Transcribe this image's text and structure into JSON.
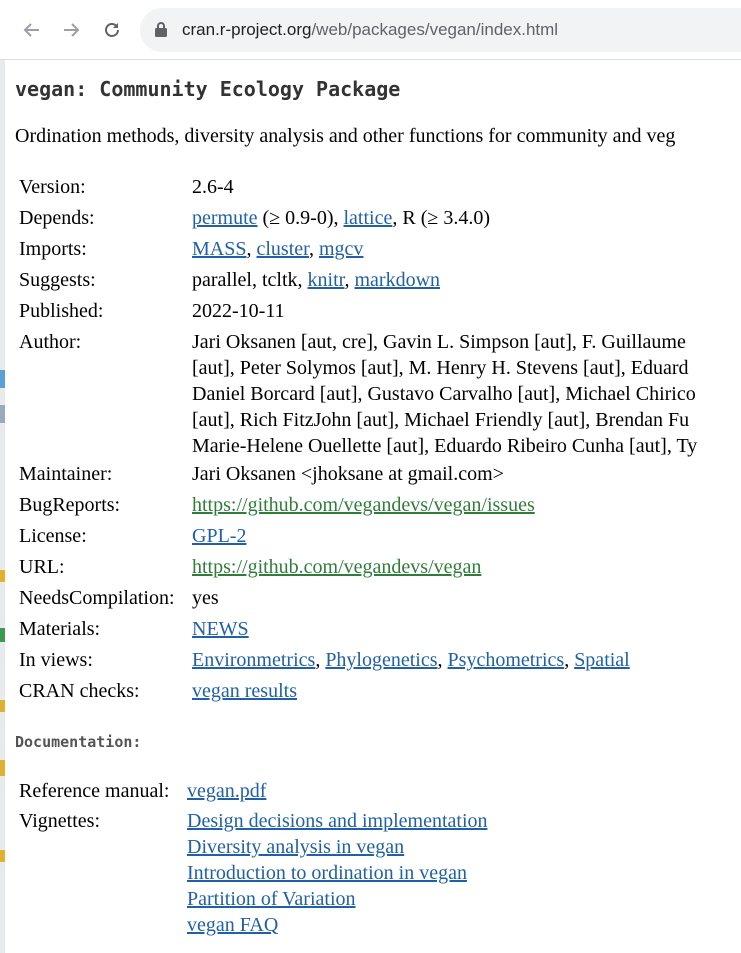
{
  "browser": {
    "url_host": "cran.r-project.org",
    "url_path": "/web/packages/vegan/index.html"
  },
  "page": {
    "title": "vegan: Community Ecology Package",
    "description": "Ordination methods, diversity analysis and other functions for community and veg",
    "fields": {
      "version": {
        "label": "Version:",
        "value": "2.6-4"
      },
      "depends": {
        "label": "Depends:",
        "link1": "permute",
        "text1": " (≥ 0.9-0), ",
        "link2": "lattice",
        "text2": ", R (≥ 3.4.0)"
      },
      "imports": {
        "label": "Imports:",
        "link1": "MASS",
        "sep1": ", ",
        "link2": "cluster",
        "sep2": ", ",
        "link3": "mgcv"
      },
      "suggests": {
        "label": "Suggests:",
        "text1": "parallel, tcltk, ",
        "link1": "knitr",
        "sep1": ", ",
        "link2": "markdown"
      },
      "published": {
        "label": "Published:",
        "value": "2022-10-11"
      },
      "author": {
        "label": "Author:",
        "lines": [
          "Jari Oksanen [aut, cre], Gavin L. Simpson [aut], F. Guillaume",
          "[aut], Peter Solymos [aut], M. Henry H. Stevens [aut], Eduard",
          "Daniel Borcard [aut], Gustavo Carvalho [aut], Michael Chirico",
          "[aut], Rich FitzJohn [aut], Michael Friendly [aut], Brendan Fu",
          "Marie-Helene Ouellette [aut], Eduardo Ribeiro Cunha [aut], Ty"
        ]
      },
      "maintainer": {
        "label": "Maintainer:",
        "value": "Jari Oksanen <jhoksane at gmail.com>"
      },
      "bugreports": {
        "label": "BugReports:",
        "link": "https://github.com/vegandevs/vegan/issues"
      },
      "license": {
        "label": "License:",
        "link": "GPL-2"
      },
      "url": {
        "label": "URL:",
        "link": "https://github.com/vegandevs/vegan"
      },
      "needscompilation": {
        "label": "NeedsCompilation:",
        "value": "yes"
      },
      "materials": {
        "label": "Materials:",
        "link": "NEWS"
      },
      "inviews": {
        "label": "In views:",
        "link1": "Environmetrics",
        "sep1": ", ",
        "link2": "Phylogenetics",
        "sep2": ", ",
        "link3": "Psychometrics",
        "sep3": ", ",
        "link4": "Spatial"
      },
      "cranchecks": {
        "label": "CRAN checks:",
        "link": "vegan results"
      }
    },
    "documentation": {
      "heading": "Documentation:",
      "reference_label": "Reference manual:",
      "reference_link": "vegan.pdf",
      "vignettes_label": "Vignettes:",
      "vignettes": [
        "Design decisions and implementation",
        "Diversity analysis in vegan",
        "Introduction to ordination in vegan",
        "Partition of Variation",
        "vegan FAQ"
      ]
    }
  }
}
